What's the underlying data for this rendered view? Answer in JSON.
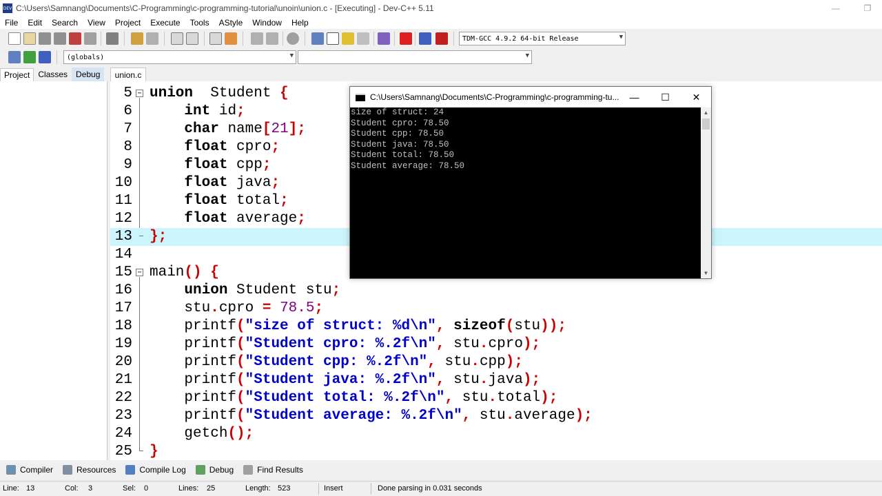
{
  "window": {
    "title": "C:\\Users\\Samnang\\Documents\\C-Programming\\c-programming-tutorial\\unoin\\union.c - [Executing] - Dev-C++ 5.11",
    "app_icon_text": "DEV",
    "minimize": "—",
    "restore": "❐"
  },
  "menu": [
    "File",
    "Edit",
    "Search",
    "View",
    "Project",
    "Execute",
    "Tools",
    "AStyle",
    "Window",
    "Help"
  ],
  "toolbar": {
    "compiler_select": "TDM-GCC 4.9.2 64-bit Release",
    "globals_select": "(globals)",
    "members_select": ""
  },
  "left_panel": {
    "tabs": [
      "Project",
      "Classes",
      "Debug"
    ]
  },
  "editor": {
    "file_tab": "union.c",
    "lines": [
      {
        "n": "5",
        "fold": "open",
        "tokens": [
          [
            "kw",
            "union"
          ],
          [
            "",
            "  Student "
          ],
          [
            "sym",
            "{"
          ]
        ]
      },
      {
        "n": "6",
        "tokens": [
          [
            "",
            "    "
          ],
          [
            "kw",
            "int"
          ],
          [
            "",
            " id"
          ],
          [
            "sym",
            ";"
          ]
        ]
      },
      {
        "n": "7",
        "tokens": [
          [
            "",
            "    "
          ],
          [
            "kw",
            "char"
          ],
          [
            "",
            " name"
          ],
          [
            "sym",
            "["
          ],
          [
            "num",
            "21"
          ],
          [
            "sym",
            "];"
          ]
        ]
      },
      {
        "n": "8",
        "tokens": [
          [
            "",
            "    "
          ],
          [
            "kw",
            "float"
          ],
          [
            "",
            " cpro"
          ],
          [
            "sym",
            ";"
          ]
        ]
      },
      {
        "n": "9",
        "tokens": [
          [
            "",
            "    "
          ],
          [
            "kw",
            "float"
          ],
          [
            "",
            " cpp"
          ],
          [
            "sym",
            ";"
          ]
        ]
      },
      {
        "n": "10",
        "tokens": [
          [
            "",
            "    "
          ],
          [
            "kw",
            "float"
          ],
          [
            "",
            " java"
          ],
          [
            "sym",
            ";"
          ]
        ]
      },
      {
        "n": "11",
        "tokens": [
          [
            "",
            "    "
          ],
          [
            "kw",
            "float"
          ],
          [
            "",
            " total"
          ],
          [
            "sym",
            ";"
          ]
        ]
      },
      {
        "n": "12",
        "tokens": [
          [
            "",
            "    "
          ],
          [
            "kw",
            "float"
          ],
          [
            "",
            " average"
          ],
          [
            "sym",
            ";"
          ]
        ]
      },
      {
        "n": "13",
        "fold": "end",
        "highlight": true,
        "tokens": [
          [
            "sym",
            "};"
          ]
        ]
      },
      {
        "n": "14",
        "tokens": []
      },
      {
        "n": "15",
        "fold": "open",
        "tokens": [
          [
            "",
            "main"
          ],
          [
            "sym",
            "()"
          ],
          [
            "",
            " "
          ],
          [
            "sym",
            "{"
          ]
        ]
      },
      {
        "n": "16",
        "tokens": [
          [
            "",
            "    "
          ],
          [
            "kw",
            "union"
          ],
          [
            "",
            " Student stu"
          ],
          [
            "sym",
            ";"
          ]
        ]
      },
      {
        "n": "17",
        "tokens": [
          [
            "",
            "    stu"
          ],
          [
            "sym",
            "."
          ],
          [
            "",
            "cpro "
          ],
          [
            "sym",
            "="
          ],
          [
            "",
            " "
          ],
          [
            "num",
            "78.5"
          ],
          [
            "sym",
            ";"
          ]
        ]
      },
      {
        "n": "18",
        "tokens": [
          [
            "",
            "    printf"
          ],
          [
            "sym",
            "("
          ],
          [
            "str",
            "\"size of struct: %d\\n\""
          ],
          [
            "sym",
            ","
          ],
          [
            "",
            " "
          ],
          [
            "kw",
            "sizeof"
          ],
          [
            "sym",
            "("
          ],
          [
            "",
            "stu"
          ],
          [
            "sym",
            "));"
          ]
        ]
      },
      {
        "n": "19",
        "tokens": [
          [
            "",
            "    printf"
          ],
          [
            "sym",
            "("
          ],
          [
            "str",
            "\"Student cpro: %.2f\\n\""
          ],
          [
            "sym",
            ","
          ],
          [
            "",
            " stu"
          ],
          [
            "sym",
            "."
          ],
          [
            "",
            "cpro"
          ],
          [
            "sym",
            ");"
          ]
        ]
      },
      {
        "n": "20",
        "tokens": [
          [
            "",
            "    printf"
          ],
          [
            "sym",
            "("
          ],
          [
            "str",
            "\"Student cpp: %.2f\\n\""
          ],
          [
            "sym",
            ","
          ],
          [
            "",
            " stu"
          ],
          [
            "sym",
            "."
          ],
          [
            "",
            "cpp"
          ],
          [
            "sym",
            ");"
          ]
        ]
      },
      {
        "n": "21",
        "tokens": [
          [
            "",
            "    printf"
          ],
          [
            "sym",
            "("
          ],
          [
            "str",
            "\"Student java: %.2f\\n\""
          ],
          [
            "sym",
            ","
          ],
          [
            "",
            " stu"
          ],
          [
            "sym",
            "."
          ],
          [
            "",
            "java"
          ],
          [
            "sym",
            ");"
          ]
        ]
      },
      {
        "n": "22",
        "tokens": [
          [
            "",
            "    printf"
          ],
          [
            "sym",
            "("
          ],
          [
            "str",
            "\"Student total: %.2f\\n\""
          ],
          [
            "sym",
            ","
          ],
          [
            "",
            " stu"
          ],
          [
            "sym",
            "."
          ],
          [
            "",
            "total"
          ],
          [
            "sym",
            ");"
          ]
        ]
      },
      {
        "n": "23",
        "tokens": [
          [
            "",
            "    printf"
          ],
          [
            "sym",
            "("
          ],
          [
            "str",
            "\"Student average: %.2f\\n\""
          ],
          [
            "sym",
            ","
          ],
          [
            "",
            " stu"
          ],
          [
            "sym",
            "."
          ],
          [
            "",
            "average"
          ],
          [
            "sym",
            ");"
          ]
        ]
      },
      {
        "n": "24",
        "tokens": [
          [
            "",
            "    getch"
          ],
          [
            "sym",
            "();"
          ]
        ]
      },
      {
        "n": "25",
        "fold": "end",
        "tokens": [
          [
            "sym",
            "}"
          ]
        ]
      }
    ]
  },
  "console": {
    "title": "C:\\Users\\Samnang\\Documents\\C-Programming\\c-programming-tu...",
    "minimize": "—",
    "maximize": "☐",
    "close": "✕",
    "output": [
      "size of struct: 24",
      "Student cpro: 78.50",
      "Student cpp: 78.50",
      "Student java: 78.50",
      "Student total: 78.50",
      "Student average: 78.50"
    ],
    "scroll_up": "▲",
    "scroll_down": "▼"
  },
  "bottom_tabs": [
    "Compiler",
    "Resources",
    "Compile Log",
    "Debug",
    "Find Results"
  ],
  "status": {
    "line_label": "Line:",
    "line": "13",
    "col_label": "Col:",
    "col": "3",
    "sel_label": "Sel:",
    "sel": "0",
    "lines_label": "Lines:",
    "lines": "25",
    "length_label": "Length:",
    "length": "523",
    "mode": "Insert",
    "message": "Done parsing in 0.031 seconds"
  },
  "colors": {
    "keyword": "#000000",
    "symbol": "#cc0000",
    "number": "#800080",
    "string": "#0000c8",
    "current_line": "#ccf5fb"
  }
}
